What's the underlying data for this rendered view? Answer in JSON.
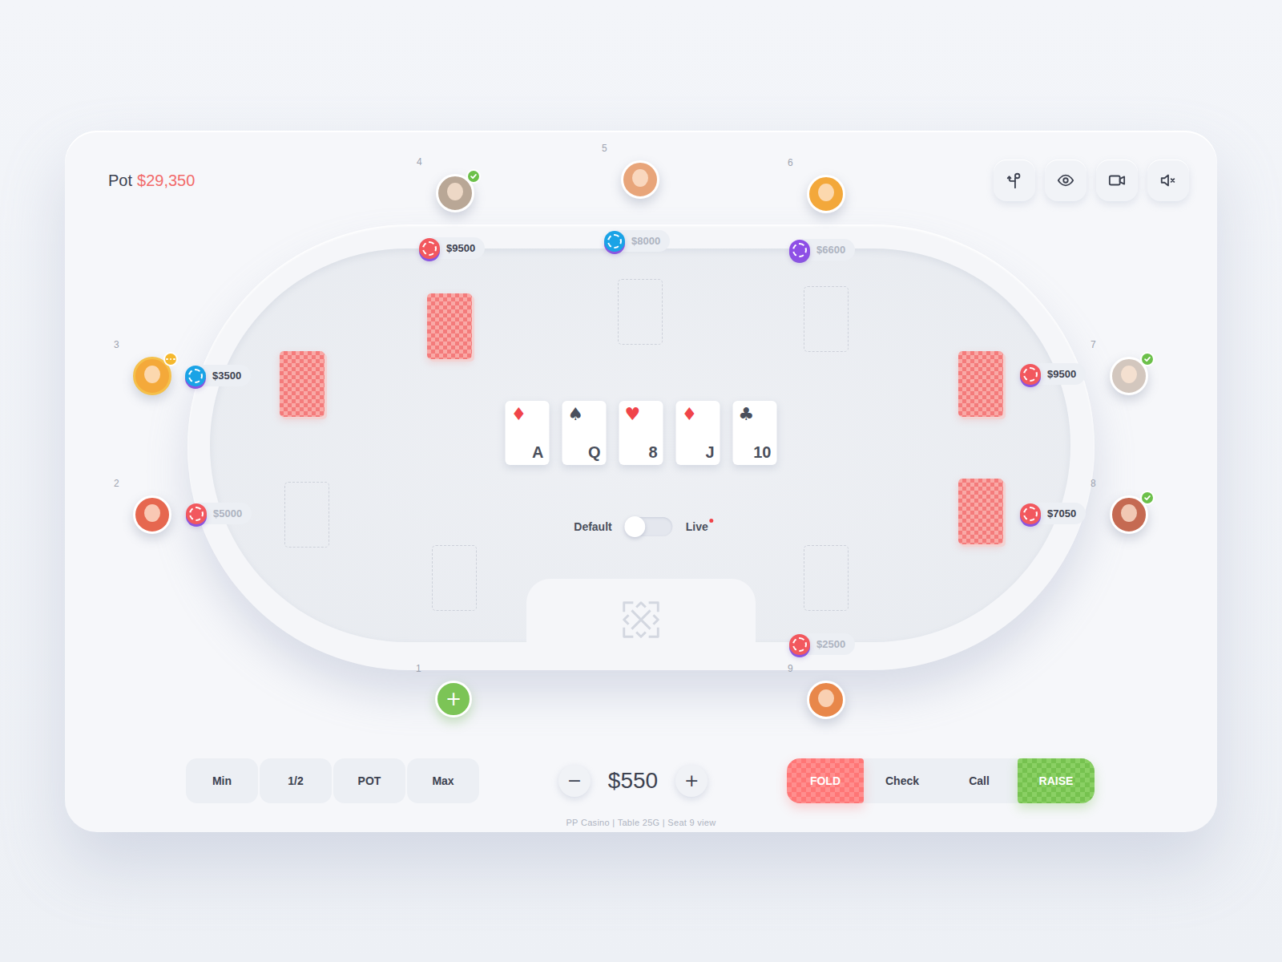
{
  "pot": {
    "label": "Pot",
    "amount": "$29,350"
  },
  "toolbar": {
    "muted": true
  },
  "seats": [
    {
      "number": "1",
      "occupied": false,
      "join": "+",
      "has_cards": false
    },
    {
      "number": "2",
      "occupied": true,
      "avatar_color": "#e6674f",
      "ready": false,
      "typing": false,
      "has_cards": false,
      "stack": "$5000",
      "stack_active": false,
      "chip_color": "#f2585e"
    },
    {
      "number": "3",
      "occupied": true,
      "avatar_color": "#f4a93a",
      "ready": false,
      "typing": true,
      "has_cards": true,
      "stack": "$3500",
      "stack_active": true,
      "chip_color": "#1aa3e6"
    },
    {
      "number": "4",
      "occupied": true,
      "avatar_color": "#b9a796",
      "ready": true,
      "typing": false,
      "has_cards": true,
      "stack": "$9500",
      "stack_active": true,
      "chip_color": "#f2585e"
    },
    {
      "number": "5",
      "occupied": true,
      "avatar_color": "#e8a57a",
      "ready": false,
      "typing": false,
      "has_cards": false,
      "stack": "$8000",
      "stack_active": false,
      "chip_color": "#1aa3e6"
    },
    {
      "number": "6",
      "occupied": true,
      "avatar_color": "#f3a83b",
      "ready": false,
      "typing": false,
      "has_cards": false,
      "stack": "$6600",
      "stack_active": false,
      "chip_color": "#8e4fe6"
    },
    {
      "number": "7",
      "occupied": true,
      "avatar_color": "#d3c7be",
      "ready": true,
      "typing": false,
      "has_cards": true,
      "stack": "$9500",
      "stack_active": true,
      "chip_color": "#f2585e"
    },
    {
      "number": "8",
      "occupied": true,
      "avatar_color": "#c56a52",
      "ready": true,
      "typing": false,
      "has_cards": true,
      "stack": "$7050",
      "stack_active": true,
      "chip_color": "#f2585e"
    },
    {
      "number": "9",
      "occupied": true,
      "avatar_color": "#e8874a",
      "ready": false,
      "typing": false,
      "has_cards": false,
      "stack": "$2500",
      "stack_active": false,
      "chip_color": "#f2585e"
    }
  ],
  "board": [
    {
      "rank": "A",
      "suit": "♦",
      "color": "#f0444a"
    },
    {
      "rank": "Q",
      "suit": "♠",
      "color": "#4a4f5c"
    },
    {
      "rank": "8",
      "suit": "♥",
      "color": "#f0444a"
    },
    {
      "rank": "J",
      "suit": "♦",
      "color": "#f0444a"
    },
    {
      "rank": "10",
      "suit": "♣",
      "color": "#4a4f5c"
    }
  ],
  "toggle": {
    "left": "Default",
    "right": "Live",
    "on": false,
    "live_dot": true
  },
  "bet": {
    "presets": [
      "Min",
      "1/2",
      "POT",
      "Max"
    ],
    "decrement": "−",
    "amount": "$550",
    "increment": "+"
  },
  "actions": [
    {
      "label": "FOLD",
      "kind": "fold"
    },
    {
      "label": "Check",
      "kind": "plain"
    },
    {
      "label": "Call",
      "kind": "plain"
    },
    {
      "label": "RAISE",
      "kind": "raise"
    }
  ],
  "footer": "PP Casino | Table 25G | Seat 9 view"
}
